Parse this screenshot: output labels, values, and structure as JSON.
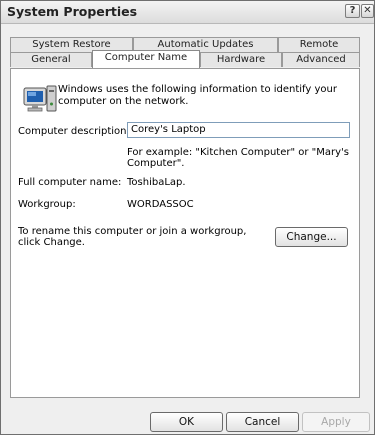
{
  "window": {
    "title": "System Properties",
    "help_glyph": "?",
    "close_glyph": "✕"
  },
  "tabs_row1": [
    "System Restore",
    "Automatic Updates",
    "Remote"
  ],
  "tabs_row2": [
    "General",
    "Computer Name",
    "Hardware",
    "Advanced"
  ],
  "active_tab": "Computer Name",
  "content": {
    "intro_text": "Windows uses the following information to identify your computer on the network.",
    "description_label": "Computer description:",
    "description_value": "Corey's Laptop",
    "example_text": "For example: \"Kitchen Computer\" or \"Mary's Computer\".",
    "full_name_label": "Full computer name:",
    "full_name_value": "ToshibaLap.",
    "workgroup_label": "Workgroup:",
    "workgroup_value": "WORDASSOC",
    "rename_text": "To rename this computer or join a workgroup, click Change.",
    "change_button": "Change..."
  },
  "footer": {
    "ok": "OK",
    "cancel": "Cancel",
    "apply": "Apply"
  },
  "icons": {
    "computer": "computer-icon"
  }
}
